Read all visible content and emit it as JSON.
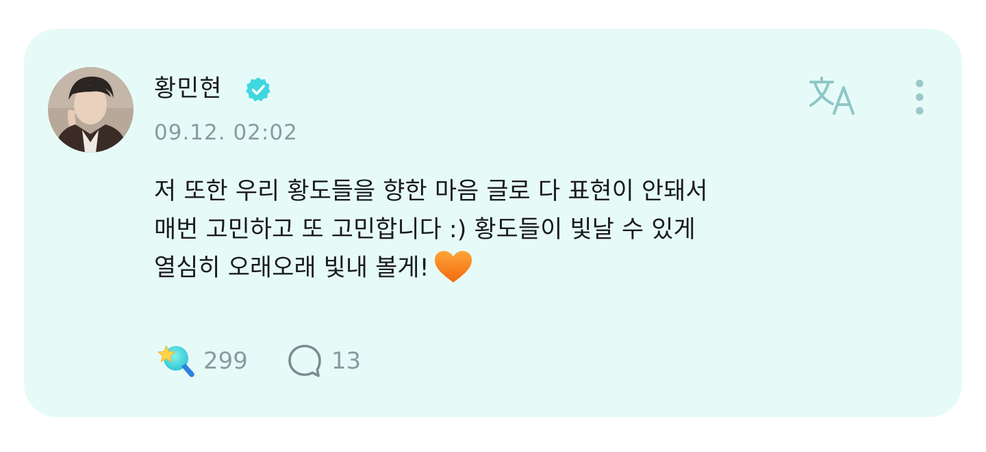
{
  "post": {
    "author": {
      "name": "황민현",
      "verified": true
    },
    "timestamp": "09.12. 02:02",
    "body_lines": [
      "저 또한 우리 황도들을 향한 마음 글로 다 표현이 안돼서",
      "매번 고민하고 또 고민합니다 :) 황도들이 빛날 수 있게",
      "열심히 오래오래 빛내 볼게!"
    ],
    "body_emoji": "orange-heart",
    "reactions": {
      "likes": "299",
      "comments": "13"
    },
    "actions": {
      "translate_icon": "translate-icon",
      "more_icon": "more-vertical-icon"
    }
  },
  "colors": {
    "card_background": "#e6fbf8",
    "text_primary": "#1b1b1b",
    "text_secondary": "#8a9aa0",
    "verified_badge": "#3fd8e0",
    "accent_icon": "#9dd6d3"
  }
}
